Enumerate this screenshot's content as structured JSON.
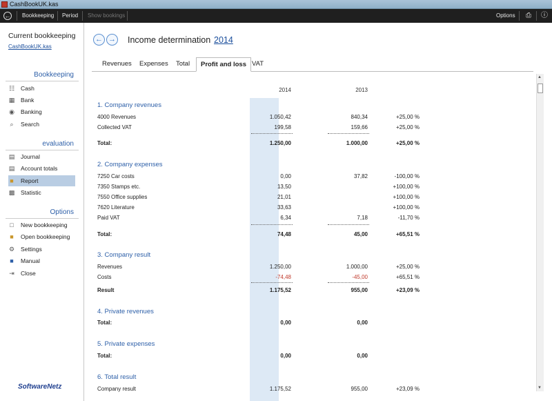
{
  "window": {
    "title": "CashBookUK.kas"
  },
  "menubar": {
    "items": [
      "Bookkeeping",
      "Period",
      "Show bookings"
    ],
    "options_label": "Options"
  },
  "sidebar": {
    "current_title": "Current bookkeeping",
    "current_file": "CashBookUK.kas",
    "sections": [
      {
        "title": "Bookkeeping",
        "items": [
          {
            "label": "Cash",
            "icon": "cash-icon"
          },
          {
            "label": "Bank",
            "icon": "bank-icon"
          },
          {
            "label": "Banking",
            "icon": "globe-icon"
          },
          {
            "label": "Search",
            "icon": "search-icon"
          }
        ]
      },
      {
        "title": "evaluation",
        "items": [
          {
            "label": "Journal",
            "icon": "journal-icon"
          },
          {
            "label": "Account totals",
            "icon": "totals-icon"
          },
          {
            "label": "Report",
            "icon": "folder-icon",
            "active": true
          },
          {
            "label": "Statistic",
            "icon": "chart-icon"
          }
        ]
      },
      {
        "title": "Options",
        "items": [
          {
            "label": "New bookkeeping",
            "icon": "new-file-icon"
          },
          {
            "label": "Open bookkeeping",
            "icon": "open-folder-icon"
          },
          {
            "label": "Settings",
            "icon": "gear-icon"
          },
          {
            "label": "Manual",
            "icon": "book-icon"
          },
          {
            "label": "Close",
            "icon": "close-icon"
          }
        ]
      }
    ],
    "logo": "SoftwareNetz"
  },
  "header": {
    "title": "Income determination",
    "year": "2014"
  },
  "tabs": [
    "Revenues",
    "Expenses",
    "Total",
    "Profit and loss",
    "VAT"
  ],
  "report": {
    "years": [
      "2014",
      "2013"
    ],
    "sections": [
      {
        "title": "1. Company revenues",
        "rows": [
          {
            "label": "4000 Revenues",
            "y2014": "1.050,42",
            "y2013": "840,34",
            "change": "+25,00 %"
          },
          {
            "label": "Collected VAT",
            "y2014": "199,58",
            "y2013": "159,66",
            "change": "+25,00 %"
          }
        ],
        "total": {
          "label": "Total:",
          "y2014": "1.250,00",
          "y2013": "1.000,00",
          "change": "+25,00 %"
        }
      },
      {
        "title": "2. Company expenses",
        "rows": [
          {
            "label": "7250 Car costs",
            "y2014": "0,00",
            "y2013": "37,82",
            "change": "-100,00 %"
          },
          {
            "label": "7350 Stamps etc.",
            "y2014": "13,50",
            "y2013": "",
            "change": "+100,00 %"
          },
          {
            "label": "7550 Office supplies",
            "y2014": "21,01",
            "y2013": "",
            "change": "+100,00 %"
          },
          {
            "label": "7620 Literature",
            "y2014": "33,63",
            "y2013": "",
            "change": "+100,00 %"
          },
          {
            "label": "Paid VAT",
            "y2014": "6,34",
            "y2013": "7,18",
            "change": "-11,70 %"
          }
        ],
        "total": {
          "label": "Total:",
          "y2014": "74,48",
          "y2013": "45,00",
          "change": "+65,51 %"
        }
      },
      {
        "title": "3. Company result",
        "rows": [
          {
            "label": "Revenues",
            "y2014": "1.250,00",
            "y2013": "1.000,00",
            "change": "+25,00 %"
          },
          {
            "label": "Costs",
            "y2014": "-74,48",
            "y2013": "-45,00",
            "change": "+65,51 %"
          }
        ],
        "total": {
          "label": "Result",
          "y2014": "1.175,52",
          "y2013": "955,00",
          "change": "+23,09 %"
        }
      },
      {
        "title": "4. Private revenues",
        "rows": [],
        "total": {
          "label": "Total:",
          "y2014": "0,00",
          "y2013": "0,00",
          "change": ""
        }
      },
      {
        "title": "5. Private expenses",
        "rows": [],
        "total": {
          "label": "Total:",
          "y2014": "0,00",
          "y2013": "0,00",
          "change": ""
        }
      },
      {
        "title": "6. Total result",
        "rows": [
          {
            "label": "Company result",
            "y2014": "1.175,52",
            "y2013": "955,00",
            "change": "+23,09 %"
          }
        ]
      }
    ]
  }
}
